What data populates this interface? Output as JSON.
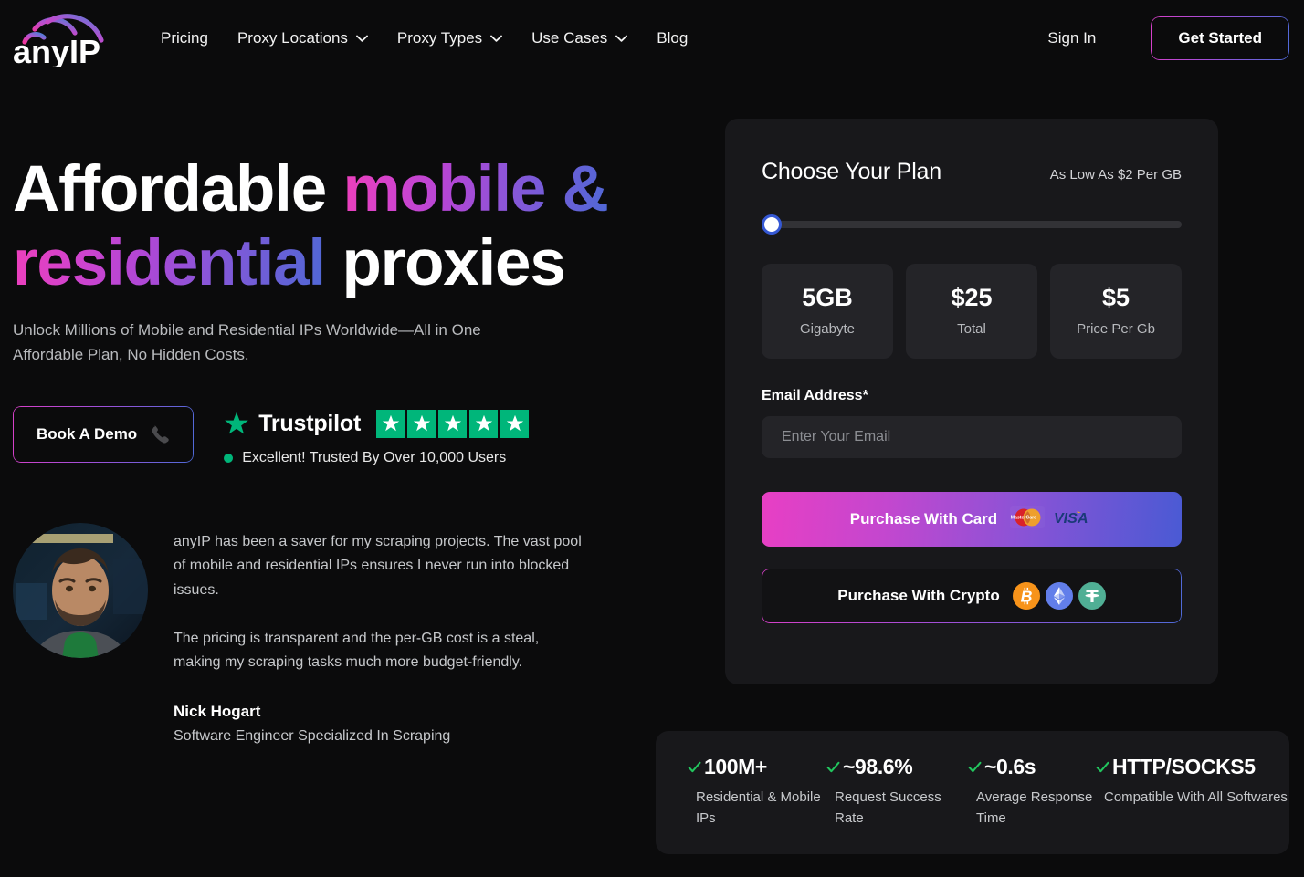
{
  "brand": {
    "name": "anyIP",
    "logo_icon": "anyip-cloud-logo"
  },
  "header": {
    "nav": [
      {
        "label": "Pricing",
        "has_dropdown": false
      },
      {
        "label": "Proxy Locations",
        "has_dropdown": true
      },
      {
        "label": "Proxy Types",
        "has_dropdown": true
      },
      {
        "label": "Use Cases",
        "has_dropdown": true
      },
      {
        "label": "Blog",
        "has_dropdown": false
      }
    ],
    "sign_in": "Sign In",
    "get_started": "Get Started"
  },
  "hero": {
    "title_part1": "Affordable ",
    "title_gradient1": "mobile &",
    "title_gradient2": "residential",
    "title_part2": " proxies",
    "subtitle": "Unlock Millions of Mobile and Residential IPs Worldwide—All in One Affordable Plan, No Hidden Costs.",
    "book_demo": "Book A Demo",
    "phone_icon": "phone-icon"
  },
  "trustpilot": {
    "name": "Trustpilot",
    "star_icon": "star-icon",
    "star_count": 5,
    "rating_text": "Excellent! Trusted By Over 10,000 Users",
    "green": "#00B67A"
  },
  "testimonial": {
    "avatar_icon": "avatar-photo",
    "paragraphs": [
      "anyIP has been a saver for my scraping projects. The vast pool of mobile and residential IPs ensures I never run into blocked issues.",
      "The pricing is transparent and the per-GB cost is a steal, making my scraping tasks much more budget-friendly."
    ],
    "author_name": "Nick Hogart",
    "author_role": "Software Engineer Specialized In Scraping"
  },
  "plan": {
    "title": "Choose Your Plan",
    "note": "As Low As $2 Per GB",
    "slider": {
      "value": 0,
      "min": 0,
      "max": 100
    },
    "cards": [
      {
        "value": "5GB",
        "label": "Gigabyte"
      },
      {
        "value": "$25",
        "label": "Total"
      },
      {
        "value": "$5",
        "label": "Price Per Gb"
      }
    ],
    "email_label": "Email Address*",
    "email_value": "",
    "email_placeholder": "Enter Your Email",
    "purchase_card": "Purchase With Card",
    "purchase_card_icons": [
      "mastercard-icon",
      "visa-icon"
    ],
    "purchase_crypto": "Purchase With Crypto",
    "purchase_crypto_icons": [
      "bitcoin-icon",
      "ethereum-icon",
      "tether-icon"
    ]
  },
  "stats": [
    {
      "value": "100M+",
      "desc": "Residential & Mobile IPs"
    },
    {
      "value": "~98.6%",
      "desc": "Request Success Rate"
    },
    {
      "value": "~0.6s",
      "desc": "Average Response Time"
    },
    {
      "value": "HTTP/SOCKS5",
      "desc": "Compatible With All Softwares"
    }
  ],
  "colors": {
    "page_bg": "#0B0B0C",
    "panel_bg": "#18181B",
    "card_bg": "#242428",
    "accent_pink": "#E83FC4",
    "accent_blue": "#4A5AD4",
    "check_green": "#22C55E"
  }
}
